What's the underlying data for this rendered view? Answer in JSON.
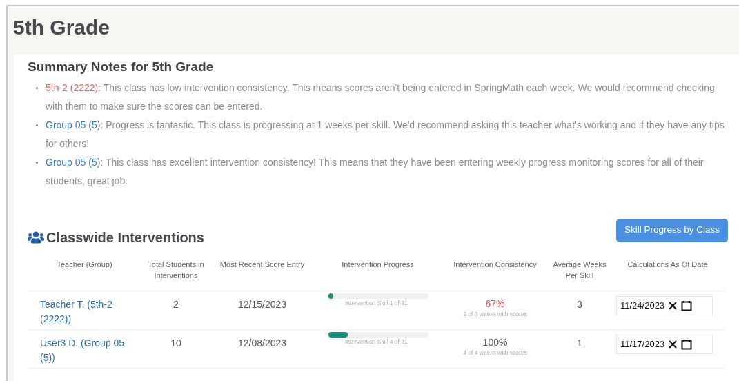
{
  "page_title": "5th Grade",
  "summary": {
    "title": "Summary Notes for 5th Grade",
    "notes": [
      {
        "link": "5th-2 (2222)",
        "color": "#e06666",
        "text": ": This class has low intervention consistency. This means scores aren't being entered in SpringMath each week. We would recommend checking with them to make sure the scores can be entered."
      },
      {
        "link": "Group 05 (5)",
        "color": "#3a7bbf",
        "text": ": Progress is fantastic. This class is progressing at 1 weeks per skill. We'd recommend asking this teacher what's working and if they have any tips for others!"
      },
      {
        "link": "Group 05 (5)",
        "color": "#3a7bbf",
        "text": ": This class has excellent intervention consistency! This means that they have been entering weekly progress monitoring scores for all of their students, great job."
      }
    ]
  },
  "interventions": {
    "title": "Classwide Interventions",
    "button": "Skill Progress by Class",
    "columns": [
      "Teacher (Group)",
      "Total Students in Interventions",
      "Most Recent Score Entry",
      "Intervention Progress",
      "Intervention Consistency",
      "Average Weeks Per Skill",
      "Calculations As Of Date"
    ],
    "rows": [
      {
        "teacher": "Teacher T. (5th-2 (2222))",
        "total": "2",
        "recent": "12/15/2023",
        "progress": {
          "level": 0.04,
          "label": "Intervention Skill 1 of 21"
        },
        "consistency": {
          "value": "67%",
          "color": "#d9534f",
          "detail": "2 of 3 weeks with scores"
        },
        "avg_weeks": "3",
        "as_of": "11/24/2023"
      },
      {
        "teacher": "User3 D. (Group 05 (5))",
        "total": "10",
        "recent": "12/08/2023",
        "progress": {
          "level": 0.19,
          "label": "Intervention Skill 4 of 21"
        },
        "consistency": {
          "value": "100%",
          "color": "#555555",
          "detail": "4 of 4 weeks with scores"
        },
        "avg_weeks": "1",
        "as_of": "11/17/2023"
      }
    ]
  }
}
